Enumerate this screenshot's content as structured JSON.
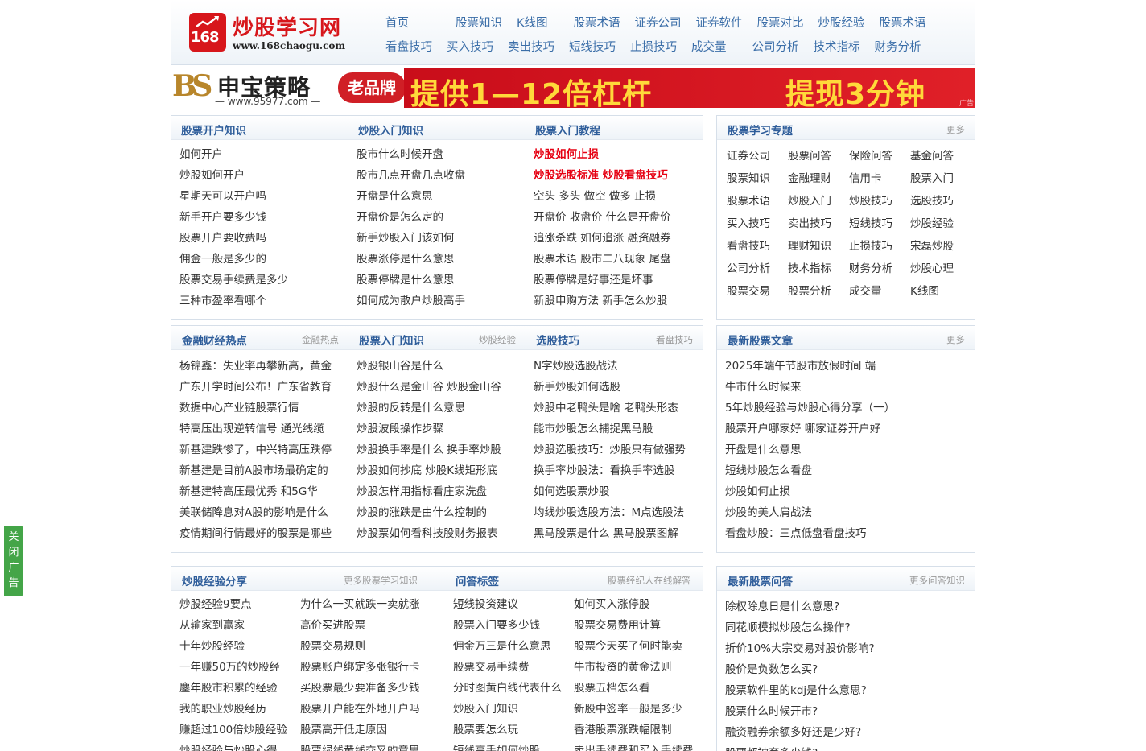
{
  "site": {
    "logo_number": "168",
    "logo_title": "炒股学习网",
    "logo_url": "www.168chaogu.com"
  },
  "nav": {
    "row1": [
      "首页",
      "股票知识",
      "K线图",
      "股票术语",
      "证券公司",
      "证券软件",
      "股票对比",
      "炒股经验",
      "股票术语"
    ],
    "row2": [
      "看盘技巧",
      "买入技巧",
      "卖出技巧",
      "短线技巧",
      "止损技巧",
      "成交量",
      "公司分析",
      "技术指标",
      "财务分析"
    ]
  },
  "banner": {
    "mark": "BS",
    "brand": "申宝策略",
    "url": "— www.95977.com —",
    "pill": "老品牌",
    "slogan1": "提供1—12倍杠杆",
    "slogan2": "提现3分钟",
    "ad_label": "广告"
  },
  "row1": {
    "col1": {
      "title": "股票开户知识",
      "items": [
        "如何开户",
        "炒股如何开户",
        "星期天可以开户吗",
        "新手开户要多少钱",
        "股票开户要收费吗",
        "佣金一般是多少的",
        "股票交易手续费是多少",
        "三种市盈率看哪个"
      ]
    },
    "col2": {
      "title": "炒股入门知识",
      "items": [
        "股市什么时候开盘",
        "股市几点开盘几点收盘",
        "开盘是什么意思",
        "开盘价是怎么定的",
        "新手炒股入门该如何",
        "股票涨停是什么意思",
        "股票停牌是什么意思",
        "如何成为散户炒股高手"
      ]
    },
    "col3": {
      "title": "股票入门教程",
      "items": [
        "炒股如何止损",
        "炒股选股标准 炒股看盘技巧",
        "空头 多头 做空 做多 止损",
        "开盘价 收盘价 什么是开盘价",
        "追涨杀跌 如何追涨 融资融券",
        "股票术语 股市二八现象 尾盘",
        "股票停牌是好事还是坏事",
        "新股申购方法 新手怎么炒股"
      ]
    },
    "topics": {
      "title": "股票学习专题",
      "more": "更多",
      "tags": [
        "证券公司",
        "股票问答",
        "保险问答",
        "基金问答",
        "股票知识",
        "金融理财",
        "信用卡",
        "股票入门",
        "股票术语",
        "炒股入门",
        "炒股技巧",
        "选股技巧",
        "买入技巧",
        "卖出技巧",
        "短线技巧",
        "炒股经验",
        "看盘技巧",
        "理财知识",
        "止损技巧",
        "宋磊炒股",
        "公司分析",
        "技术指标",
        "财务分析",
        "炒股心理",
        "股票交易",
        "股票分析",
        "成交量",
        "K线图"
      ]
    }
  },
  "row2": {
    "col1": {
      "title": "金融财经热点",
      "more": "金融热点",
      "items": [
        "杨锦鑫：失业率再攀新高，黄金",
        "广东开学时间公布！广东省教育",
        "数据中心产业链股票行情",
        "特高压出现逆转信号 通光线缆",
        "新基建跌惨了，中兴特高压跌停",
        "新基建是目前A股市场最确定的",
        "新基建特高压最优秀 和5G华",
        "美联储降息对A股的影响是什么",
        "疫情期间行情最好的股票是哪些"
      ]
    },
    "col2": {
      "title": "股票入门知识",
      "more": "炒股经验",
      "items": [
        "炒股银山谷是什么",
        "炒股什么是金山谷 炒股金山谷",
        "炒股的反转是什么意思",
        "炒股波段操作步骤",
        "炒股换手率是什么 换手率炒股",
        "炒股如何抄底 炒股K线矩形底",
        "炒股怎样用指标看庄家洗盘",
        "炒股的涨跌是由什么控制的",
        "炒股票如何看科技股财务报表"
      ]
    },
    "col3": {
      "title": "选股技巧",
      "more": "看盘技巧",
      "items": [
        "N字炒股选股战法",
        "新手炒股如何选股",
        "炒股中老鸭头是啥 老鸭头形态",
        "能市炒股怎么捕捉黑马股",
        "炒股选股技巧：炒股只有做强势",
        "换手率炒股法：看换手率选股",
        "如何选股票炒股",
        "均线炒股选股方法：M点选股法",
        "黑马股票是什么 黑马股票图解"
      ]
    },
    "latest": {
      "title": "最新股票文章",
      "more": "更多",
      "items": [
        "2025年端午节股市放假时间 端",
        "牛市什么时候来",
        "5年炒股经验与炒股心得分享（一）",
        "股票开户哪家好 哪家证券开户好",
        "开盘是什么意思",
        "短线炒股怎么看盘",
        "炒股如何止损",
        "炒股的美人肩战法",
        "看盘炒股：三点低盘看盘技巧"
      ]
    }
  },
  "row3": {
    "left": {
      "title": "炒股经验分享",
      "more": "更多股票学习知识",
      "col1": [
        "炒股经验9要点",
        "从输家到赢家",
        "十年炒股经验",
        "一年赚50万的炒股经",
        "鏖年股市积累的经验",
        "我的职业炒股经历",
        "赚超过100倍炒股经验",
        "炒股经验与炒股心得"
      ],
      "col2": [
        "为什么一买就跌一卖就涨",
        "高价买进股票",
        "股票交易规则",
        "股票账户绑定多张银行卡",
        "买股票最少要准备多少钱",
        "股票开户能在外地开户吗",
        "股票高开低走原因",
        "股票绿线黄线交叉的意思"
      ]
    },
    "mid": {
      "title": "问答标签",
      "more": "股票经纪人在线解答",
      "col1": [
        "短线投资建议",
        "股票入门要多少钱",
        "佣金万三是什么意思",
        "股票交易手续费",
        "分时图黄白线代表什么",
        "炒股入门知识",
        "股票要怎么玩",
        "短线高手如何炒股"
      ],
      "col2": [
        "如何买入涨停股",
        "股票交易费用计算",
        "股票今天买了何时能卖",
        "牛市投资的黄金法则",
        "股票五档怎么看",
        "新股中签率一般是多少",
        "香港股票涨跌幅限制",
        "卖出手续费和买入手续费"
      ]
    },
    "qa": {
      "title": "最新股票问答",
      "more": "更多问答知识",
      "items": [
        "除权除息日是什么意思?",
        "同花顺模拟炒股怎么操作?",
        "折价10%大宗交易对股价影响?",
        "股价是负数怎么买?",
        "股票软件里的kdj是什么意思?",
        "股票什么时候开市?",
        "融资融券余额多好还是少好?",
        "股票都被套多少钱?"
      ]
    }
  },
  "close_ad": "关闭广告",
  "colors": {
    "link_blue": "#3b6ea8",
    "title_blue": "#2e5d9a",
    "hot_red": "#e60012",
    "border": "#d6dfe9",
    "close_green": "#44a548"
  }
}
